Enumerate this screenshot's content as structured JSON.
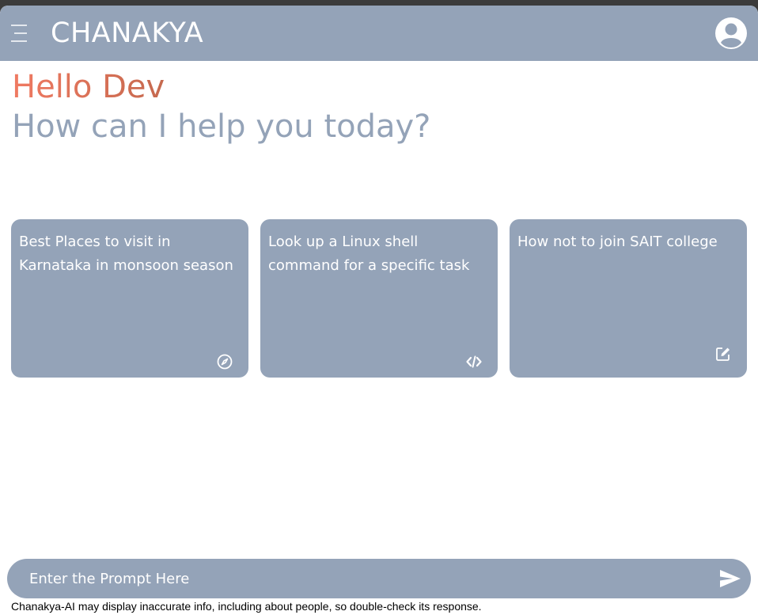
{
  "header": {
    "title": "CHANAKYA",
    "menu_icon": "hamburger-menu-icon",
    "avatar_icon": "user-circle-icon"
  },
  "hero": {
    "greeting": "Hello Dev",
    "subtitle": "How can I help you today?"
  },
  "cards": [
    {
      "text": "Best Places to visit in Karnataka in monsoon season",
      "icon": "compass-icon"
    },
    {
      "text": "Look up a Linux shell command for a specific task",
      "icon": "code-icon"
    },
    {
      "text": "How not to join SAIT college",
      "icon": "edit-icon"
    }
  ],
  "prompt": {
    "placeholder": "Enter the Prompt Here",
    "value": "",
    "send_icon": "send-icon"
  },
  "footer": {
    "disclaimer": "Chanakya-AI may display inaccurate info, including about people, so double-check its response."
  },
  "colors": {
    "accent": "#94a3b8",
    "greeting_start": "#f07a62",
    "greeting_end": "#c5694e"
  }
}
